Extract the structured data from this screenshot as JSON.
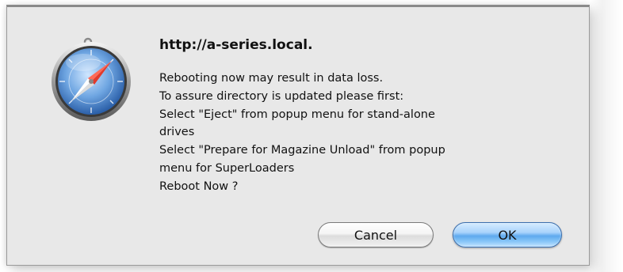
{
  "dialog": {
    "title": "http://a-series.local.",
    "message_lines": [
      "Rebooting now may result in data loss.",
      "To assure directory is updated please first:",
      "Select \"Eject\" from popup menu for stand-alone",
      "drives",
      "Select \"Prepare for Magazine Unload\" from popup",
      "menu for SuperLoaders",
      "Reboot Now ?"
    ],
    "icon": "safari-compass-icon",
    "buttons": {
      "cancel_label": "Cancel",
      "ok_label": "OK"
    }
  },
  "colors": {
    "dialog_background": "#e8e8e8",
    "default_button": "#5ea9ee",
    "text": "#111111"
  }
}
